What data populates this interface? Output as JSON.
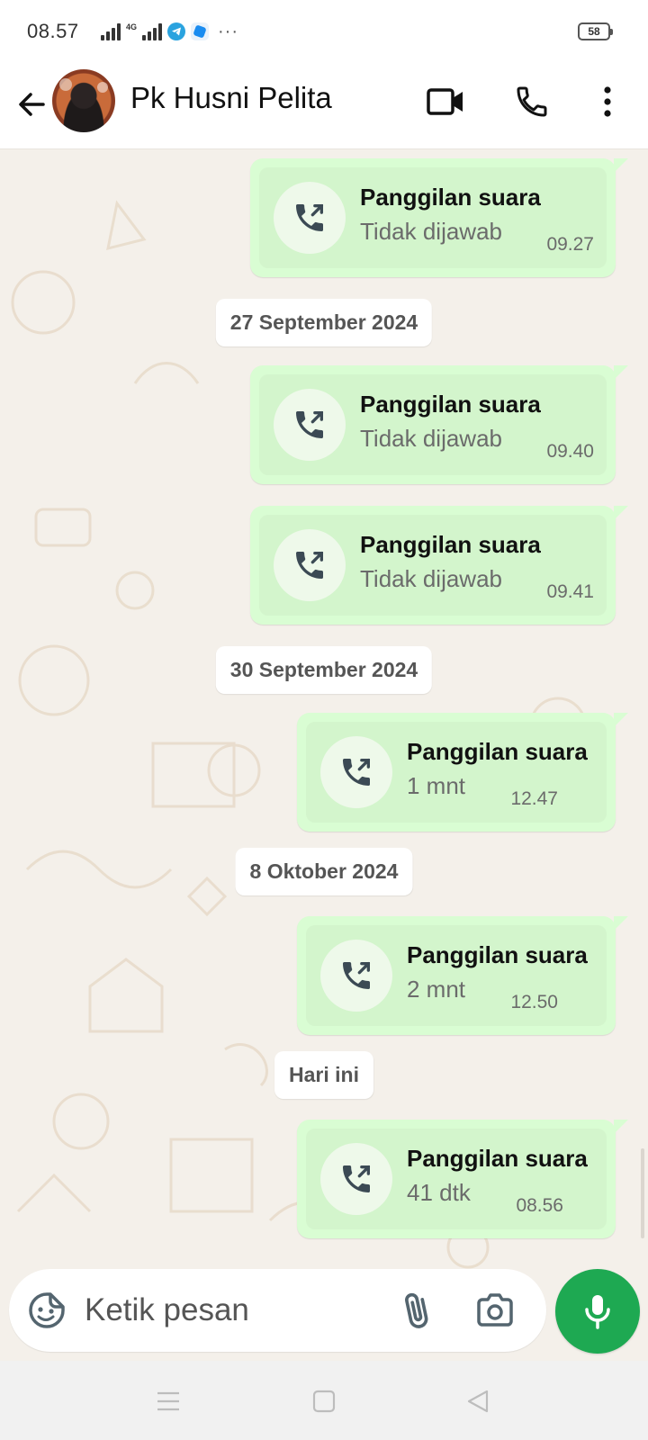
{
  "status_bar": {
    "time": "08.57",
    "network_type": "4G",
    "battery_level": "58"
  },
  "header": {
    "contact_name": "Pk Husni Pelita",
    "icons": [
      "back-arrow-icon",
      "avatar",
      "video-call-icon",
      "voice-call-icon",
      "more-options-icon"
    ]
  },
  "messages": [
    {
      "title": "Panggilan suara",
      "status": "Tidak dijawab",
      "time": "09.27"
    },
    {
      "title": "Panggilan suara",
      "status": "Tidak dijawab",
      "time": "09.40"
    },
    {
      "title": "Panggilan suara",
      "status": "Tidak dijawab",
      "time": "09.41"
    },
    {
      "title": "Panggilan suara",
      "status": "1 mnt",
      "time": "12.47"
    },
    {
      "title": "Panggilan suara",
      "status": "2 mnt",
      "time": "12.50"
    },
    {
      "title": "Panggilan suara",
      "status": "41 dtk",
      "time": "08.56"
    }
  ],
  "date_separators": [
    "27 September 2024",
    "30 September 2024",
    "8 Oktober 2024",
    "Hari ini"
  ],
  "input": {
    "placeholder": "Ketik pesan"
  },
  "colors": {
    "outgoing_bubble": "#d9fdd3",
    "mic_button": "#1ea952",
    "chat_background": "#f4f0ea"
  }
}
